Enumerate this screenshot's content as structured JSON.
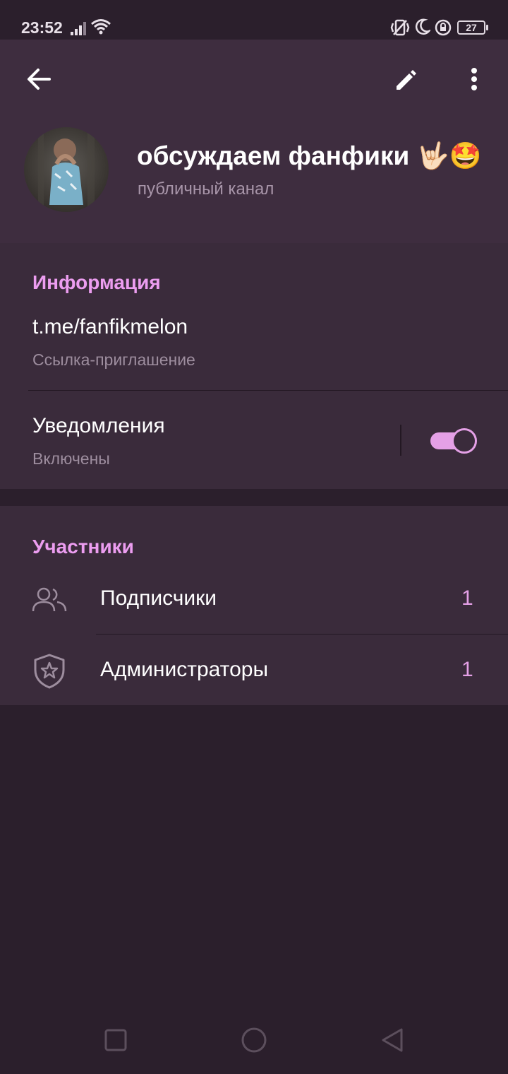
{
  "status_bar": {
    "time": "23:52",
    "battery": "27",
    "icons": [
      "signal-icon",
      "wifi-icon",
      "vibrate-icon",
      "moon-icon",
      "rotation-lock-icon",
      "battery-icon"
    ]
  },
  "header": {
    "channel_name": "обсуждаем фанфики 🤟🏻🤩",
    "channel_type": "публичный канал"
  },
  "info_section": {
    "title": "Информация",
    "link": {
      "value": "t.me/fanfikmelon",
      "caption": "Ссылка-приглашение"
    },
    "notifications": {
      "label": "Уведомления",
      "state": "Включены",
      "enabled": true
    }
  },
  "members_section": {
    "title": "Участники",
    "items": [
      {
        "label": "Подписчики",
        "count": "1",
        "icon": "users-icon"
      },
      {
        "label": "Администраторы",
        "count": "1",
        "icon": "shield-star-icon"
      }
    ]
  },
  "colors": {
    "accent": "#e4a0e6",
    "background": "#2b1f2c",
    "header": "#3e2d3f",
    "card": "#3a2b3b"
  }
}
